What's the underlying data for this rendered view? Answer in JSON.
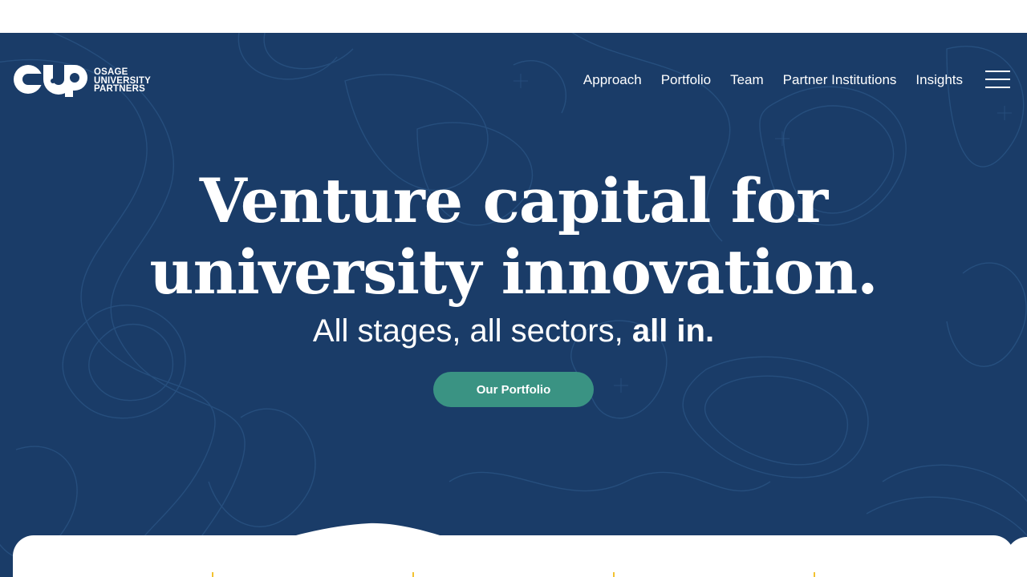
{
  "logo": {
    "line1": "OSAGE",
    "line2": "UNIVERSITY",
    "line3": "PARTNERS",
    "mark_icon": "oup-logo-mark"
  },
  "nav": {
    "items": [
      {
        "label": "Approach"
      },
      {
        "label": "Portfolio"
      },
      {
        "label": "Team"
      },
      {
        "label": "Partner Institutions"
      },
      {
        "label": "Insights"
      }
    ],
    "menu_icon": "hamburger-menu-icon"
  },
  "hero": {
    "headline_line1": "Venture capital for",
    "headline_line2": "university innovation.",
    "subline_regular": "All stages, all sectors, ",
    "subline_bold": "all in.",
    "cta_label": "Our Portfolio"
  },
  "colors": {
    "hero_background": "#1a3c68",
    "topo_lines": "#2b5585",
    "cta_background": "#3a9383",
    "accent_tick": "#f2c230",
    "text": "#ffffff"
  }
}
